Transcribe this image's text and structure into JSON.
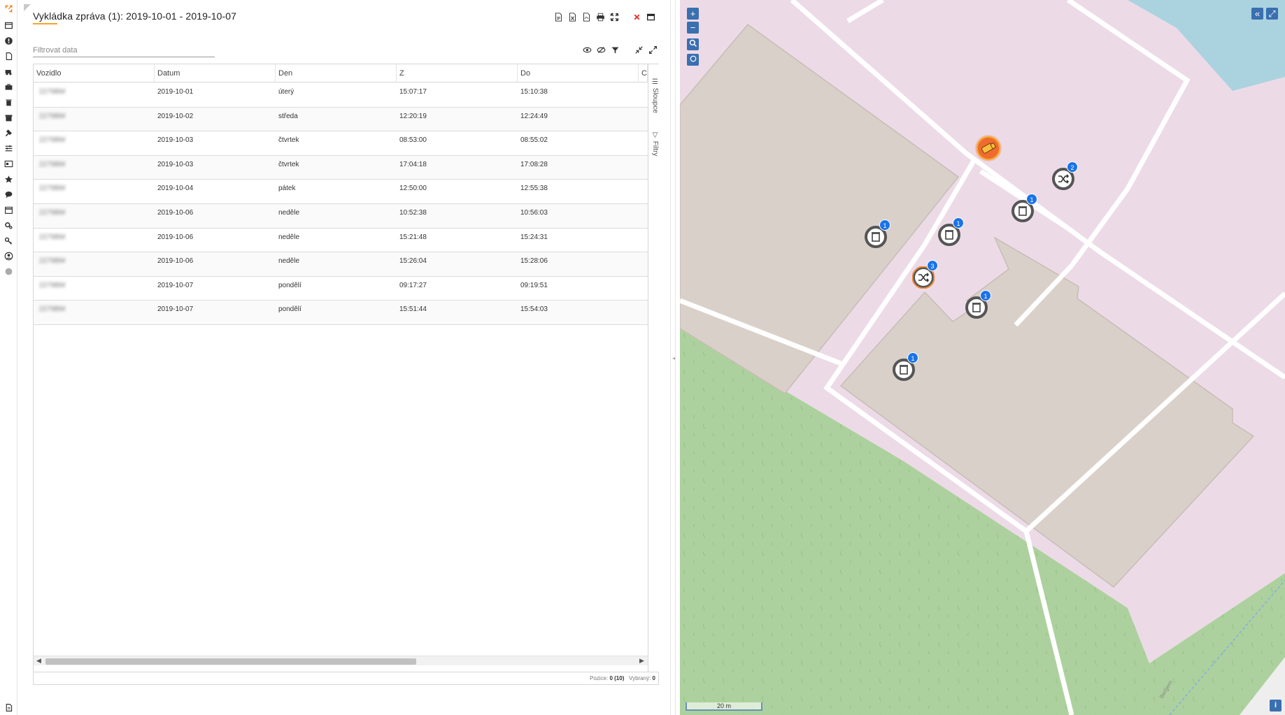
{
  "report": {
    "title": "Vykládka zpráva (1): 2019-10-01 - 2019-10-07",
    "filter_placeholder": "Filtrovat data",
    "columns": [
      "Vozidlo",
      "Datum",
      "Den",
      "Z",
      "Do",
      "C"
    ],
    "rows": [
      {
        "vehicle": "2279BM",
        "date": "2019-10-01",
        "day": "úterý",
        "from": "15:07:17",
        "to": "15:10:38"
      },
      {
        "vehicle": "2279BM",
        "date": "2019-10-02",
        "day": "středa",
        "from": "12:20:19",
        "to": "12:24:49"
      },
      {
        "vehicle": "2279BM",
        "date": "2019-10-03",
        "day": "čtvrtek",
        "from": "08:53:00",
        "to": "08:55:02"
      },
      {
        "vehicle": "2279BM",
        "date": "2019-10-03",
        "day": "čtvrtek",
        "from": "17:04:18",
        "to": "17:08:28"
      },
      {
        "vehicle": "2279BM",
        "date": "2019-10-04",
        "day": "pátek",
        "from": "12:50:00",
        "to": "12:55:38"
      },
      {
        "vehicle": "2279BM",
        "date": "2019-10-06",
        "day": "neděle",
        "from": "10:52:38",
        "to": "10:56:03"
      },
      {
        "vehicle": "2279BM",
        "date": "2019-10-06",
        "day": "neděle",
        "from": "15:21:48",
        "to": "15:24:31"
      },
      {
        "vehicle": "2279BM",
        "date": "2019-10-06",
        "day": "neděle",
        "from": "15:26:04",
        "to": "15:28:06"
      },
      {
        "vehicle": "2279BM",
        "date": "2019-10-07",
        "day": "pondělí",
        "from": "09:17:27",
        "to": "09:19:51"
      },
      {
        "vehicle": "2279BM",
        "date": "2019-10-07",
        "day": "pondělí",
        "from": "15:51:44",
        "to": "15:54:03"
      }
    ],
    "side_tabs": {
      "columns": "Sloupce",
      "filters": "Filtry"
    },
    "footer": {
      "position_label": "Pozice:",
      "position_value": "0 (10)",
      "selected_label": "Vybraný:",
      "selected_value": "0"
    }
  },
  "map": {
    "scale_label": "20 m",
    "street_label": "Bergero",
    "markers": [
      {
        "type": "trash",
        "count": "1"
      },
      {
        "type": "trash",
        "count": "1"
      },
      {
        "type": "trash",
        "count": "1"
      },
      {
        "type": "shuffle",
        "count": "2"
      },
      {
        "type": "shuffle",
        "count": "3"
      },
      {
        "type": "trash",
        "count": "1"
      },
      {
        "type": "trash",
        "count": "1"
      }
    ],
    "colors": {
      "landuse": "#ecdbe7",
      "building": "#d9d0c9",
      "forest": "#add19e",
      "water": "#aad3df",
      "road": "#ffffff",
      "control": "#3a6fb0"
    }
  },
  "colors": {
    "accent": "#f5a623",
    "close": "#e53935",
    "badge": "#1a73e8"
  }
}
